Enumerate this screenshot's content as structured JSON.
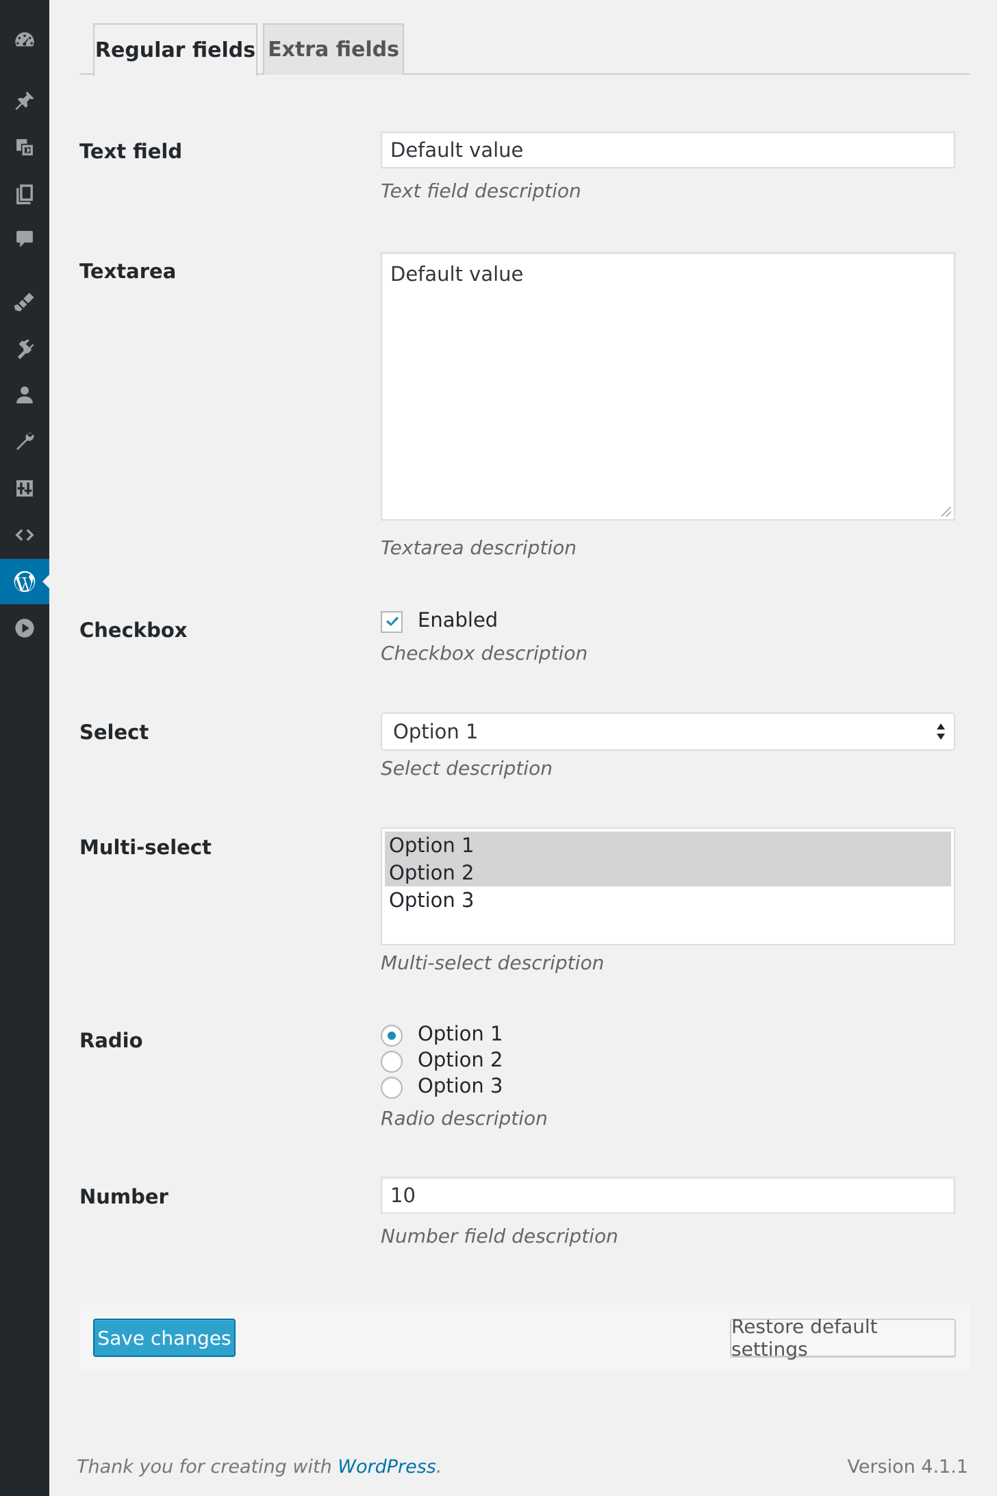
{
  "sidebar": {
    "icons": [
      "dashboard-icon",
      "pin-icon",
      "media-icon",
      "pages-icon",
      "comments-icon",
      "appearance-icon",
      "plugins-icon",
      "users-icon",
      "tools-icon",
      "settings-icon",
      "code-icon",
      "wordpress-icon",
      "play-icon"
    ],
    "active": "wordpress-icon",
    "active_color": "#0073aa"
  },
  "tabs": [
    {
      "label": "Regular fields",
      "active": true
    },
    {
      "label": "Extra fields",
      "active": false
    }
  ],
  "fields": {
    "text": {
      "label": "Text field",
      "value": "Default value",
      "description": "Text field description"
    },
    "textarea": {
      "label": "Textarea",
      "value": "Default value",
      "description": "Textarea description"
    },
    "checkbox": {
      "label": "Checkbox",
      "option_label": "Enabled",
      "checked": true,
      "description": "Checkbox description"
    },
    "select": {
      "label": "Select",
      "selected": "Option 1",
      "description": "Select description"
    },
    "multiselect": {
      "label": "Multi-select",
      "options": [
        {
          "label": "Option 1",
          "selected": true
        },
        {
          "label": "Option 2",
          "selected": true
        },
        {
          "label": "Option 3",
          "selected": false
        }
      ],
      "description": "Multi-select description"
    },
    "radio": {
      "label": "Radio",
      "options": [
        {
          "label": "Option 1",
          "checked": true
        },
        {
          "label": "Option 2",
          "checked": false
        },
        {
          "label": "Option 3",
          "checked": false
        }
      ],
      "description": "Radio description"
    },
    "number": {
      "label": "Number",
      "value": "10",
      "description": "Number field description"
    }
  },
  "actions": {
    "save_label": "Save changes",
    "restore_label": "Restore default settings"
  },
  "footer": {
    "thanks_prefix": "Thank you for creating with ",
    "thanks_link": "WordPress",
    "thanks_suffix": ".",
    "version": "Version 4.1.1"
  },
  "colors": {
    "primary_button": "#2ea2cc",
    "accent": "#1e8cbe",
    "link": "#0073aa"
  }
}
